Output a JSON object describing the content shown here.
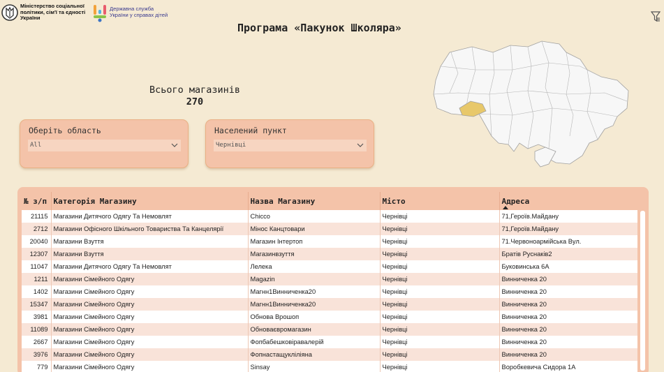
{
  "header": {
    "ministry_logo_text": "Міністерство соціальної політики, сім'ї та єдності України",
    "ditu_logo_text": "Державна служба України у справах дітей",
    "page_title": "Програма «Пакунок Школяра»",
    "filter_icon": "filter-icon"
  },
  "kpi": {
    "label": "Всього магазинів",
    "value": "270"
  },
  "slicers": {
    "region": {
      "title": "Оберіть область",
      "value": "All"
    },
    "city": {
      "title": "Населений пункт",
      "value": "Чернівці"
    }
  },
  "map": {
    "highlight_color": "#e8c86a",
    "base_color": "#f7f7f7",
    "border_color": "#a0a0a0"
  },
  "table": {
    "columns": [
      "№ з/п",
      "Категорія Магазину",
      "Назва Магазину",
      "Місто",
      "Адреса"
    ],
    "sorted_column": "Адреса",
    "rows": [
      [
        "21115",
        "Магазини Дитячого Одягу Та Немовлят",
        "Chicco",
        "Чернівці",
        "71,Героїв.Майдану"
      ],
      [
        "2712",
        "Магазини Офісного Шкільного Товариства Та Канцелярії",
        "Мінос Канцтовари",
        "Чернівці",
        "71,Героїв.Майдану"
      ],
      [
        "20040",
        "Магазини Взуття",
        "Магазин Інтертоп",
        "Чернівці",
        "71.Червоноармійська Вул."
      ],
      [
        "12307",
        "Магазини Взуття",
        "Магазинвзуття",
        "Чернівці",
        "Братів Руснаків2"
      ],
      [
        "11047",
        "Магазини Дитячого Одягу Та Немовлят",
        "Лелека",
        "Чернівці",
        "Буковинська 6А"
      ],
      [
        "1211",
        "Магазини Сімейного Одягу",
        "Magazin",
        "Чернівці",
        "Винниченка 20"
      ],
      [
        "1402",
        "Магазини Сімейного Одягу",
        "Магнн1Винниченка20",
        "Чернівці",
        "Винниченка 20"
      ],
      [
        "15347",
        "Магазини Сімейного Одягу",
        "Магнн1Винниченка20",
        "Чернівці",
        "Винниченка 20"
      ],
      [
        "3981",
        "Магазини Сімейного Одягу",
        "Обнова Врошоп",
        "Чернівці",
        "Винниченка 20"
      ],
      [
        "11089",
        "Магазини Сімейного Одягу",
        "Обноваєвромагазин",
        "Чернівці",
        "Винниченка 20"
      ],
      [
        "2667",
        "Магазини Сімейного Одягу",
        "Фопбабешковіравалерій",
        "Чернівці",
        "Винниченка 20"
      ],
      [
        "3976",
        "Магазини Сімейного Одягу",
        "Фопнастащукліліяна",
        "Чернівці",
        "Винниченка 20"
      ],
      [
        "779",
        "Магазини Сімейного Одягу",
        "Sinsay",
        "Чернівці",
        "Воробкевича Сидора 1А"
      ]
    ]
  }
}
